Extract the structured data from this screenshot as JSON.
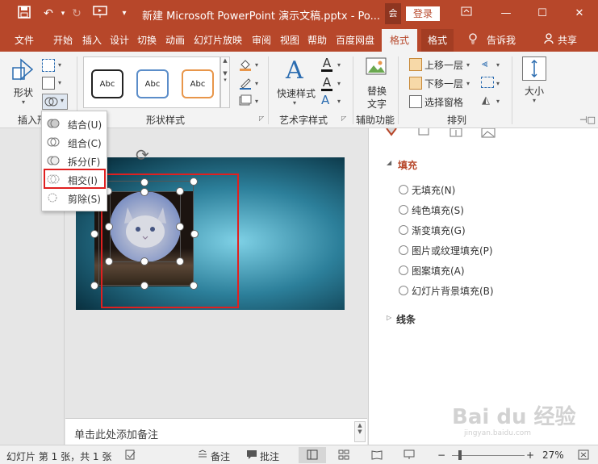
{
  "titlebar": {
    "doc_title": "新建 Microsoft PowerPoint 演示文稿.pptx - Po...",
    "account_chip": "会",
    "login_label": "登录"
  },
  "tabs": [
    "文件",
    "开始",
    "插入",
    "设计",
    "切换",
    "动画",
    "幻灯片放映",
    "审阅",
    "视图",
    "帮助",
    "百度网盘",
    "格式",
    "格式"
  ],
  "tell_me": "告诉我",
  "share": "共享",
  "ribbon": {
    "shape_label": "形状",
    "insert_shape_group": "插入形",
    "gallery_items": [
      "Abc",
      "Abc",
      "Abc"
    ],
    "shape_styles_group": "形状样式",
    "quick_styles": "快速样式",
    "art_text_group": "艺术字样式",
    "alt_text": "替换",
    "alt_text2": "文字",
    "accessibility_group": "辅助功能",
    "bring_forward": "上移一层",
    "send_backward": "下移一层",
    "selection_pane": "选择窗格",
    "arrange_group": "排列",
    "size_label": "大小"
  },
  "merge_menu": {
    "items": [
      "结合(U)",
      "组合(C)",
      "拆分(F)",
      "相交(I)",
      "剪除(S)"
    ]
  },
  "notes_placeholder": "单击此处添加备注",
  "pane": {
    "fill_header": "填充",
    "fill_options": [
      "无填充(N)",
      "纯色填充(S)",
      "渐变填充(G)",
      "图片或纹理填充(P)",
      "图案填充(A)",
      "幻灯片背景填充(B)"
    ],
    "line_header": "线条"
  },
  "status": {
    "slide_info": "幻灯片 第 1 张，共 1 张",
    "notes": "备注",
    "comments": "批注",
    "zoom": "27%"
  },
  "watermark": "Bai du 经验",
  "watermark_sub": "jingyan.baidu.com",
  "colors": {
    "accent": "#b7472a",
    "highlight_box": "#e02020"
  }
}
